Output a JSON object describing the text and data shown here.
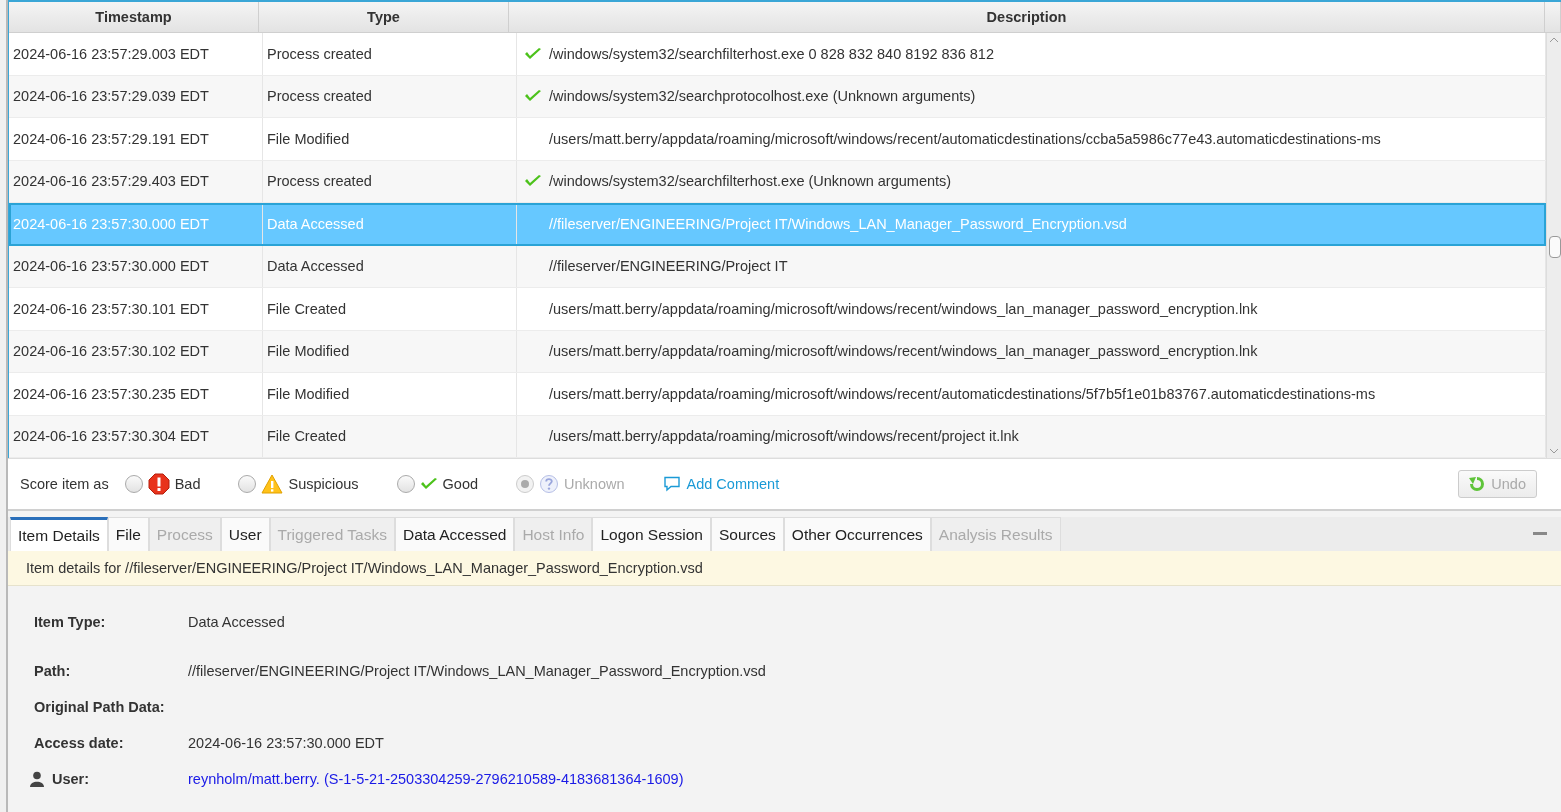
{
  "table": {
    "columns": [
      "Timestamp",
      "Type",
      "Description"
    ],
    "rows": [
      {
        "timestamp": "2024-06-16 23:57:29.003 EDT",
        "type": "Process created",
        "good": true,
        "description": "/windows/system32/searchfilterhost.exe 0 828 832 840 8192 836 812",
        "selected": false
      },
      {
        "timestamp": "2024-06-16 23:57:29.039 EDT",
        "type": "Process created",
        "good": true,
        "description": "/windows/system32/searchprotocolhost.exe (Unknown arguments)",
        "selected": false
      },
      {
        "timestamp": "2024-06-16 23:57:29.191 EDT",
        "type": "File Modified",
        "good": false,
        "description": "/users/matt.berry/appdata/roaming/microsoft/windows/recent/automaticdestinations/ccba5a5986c77e43.automaticdestinations-ms",
        "selected": false
      },
      {
        "timestamp": "2024-06-16 23:57:29.403 EDT",
        "type": "Process created",
        "good": true,
        "description": "/windows/system32/searchfilterhost.exe (Unknown arguments)",
        "selected": false
      },
      {
        "timestamp": "2024-06-16 23:57:30.000 EDT",
        "type": "Data Accessed",
        "good": false,
        "description": "//fileserver/ENGINEERING/Project IT/Windows_LAN_Manager_Password_Encryption.vsd",
        "selected": true
      },
      {
        "timestamp": "2024-06-16 23:57:30.000 EDT",
        "type": "Data Accessed",
        "good": false,
        "description": "//fileserver/ENGINEERING/Project IT",
        "selected": false
      },
      {
        "timestamp": "2024-06-16 23:57:30.101 EDT",
        "type": "File Created",
        "good": false,
        "description": "/users/matt.berry/appdata/roaming/microsoft/windows/recent/windows_lan_manager_password_encryption.lnk",
        "selected": false
      },
      {
        "timestamp": "2024-06-16 23:57:30.102 EDT",
        "type": "File Modified",
        "good": false,
        "description": "/users/matt.berry/appdata/roaming/microsoft/windows/recent/windows_lan_manager_password_encryption.lnk",
        "selected": false
      },
      {
        "timestamp": "2024-06-16 23:57:30.235 EDT",
        "type": "File Modified",
        "good": false,
        "description": "/users/matt.berry/appdata/roaming/microsoft/windows/recent/automaticdestinations/5f7b5f1e01b83767.automaticdestinations-ms",
        "selected": false
      },
      {
        "timestamp": "2024-06-16 23:57:30.304 EDT",
        "type": "File Created",
        "good": false,
        "description": "/users/matt.berry/appdata/roaming/microsoft/windows/recent/project it.lnk",
        "selected": false
      }
    ]
  },
  "score_bar": {
    "label": "Score item as",
    "options": [
      {
        "kind": "bad",
        "label": "Bad",
        "selected": false,
        "disabled": false
      },
      {
        "kind": "suspicious",
        "label": "Suspicious",
        "selected": false,
        "disabled": false
      },
      {
        "kind": "good",
        "label": "Good",
        "selected": false,
        "disabled": false
      },
      {
        "kind": "unknown",
        "label": "Unknown",
        "selected": true,
        "disabled": true
      }
    ],
    "comment_link": "Add Comment",
    "undo_button": {
      "label": "Undo",
      "disabled": true
    }
  },
  "tabs": [
    {
      "label": "Item Details",
      "selected": true,
      "disabled": false
    },
    {
      "label": "File",
      "selected": false,
      "disabled": false
    },
    {
      "label": "Process",
      "selected": false,
      "disabled": true
    },
    {
      "label": "User",
      "selected": false,
      "disabled": false
    },
    {
      "label": "Triggered Tasks",
      "selected": false,
      "disabled": true
    },
    {
      "label": "Data Accessed",
      "selected": false,
      "disabled": false
    },
    {
      "label": "Host Info",
      "selected": false,
      "disabled": true
    },
    {
      "label": "Logon Session",
      "selected": false,
      "disabled": false
    },
    {
      "label": "Sources",
      "selected": false,
      "disabled": false
    },
    {
      "label": "Other Occurrences",
      "selected": false,
      "disabled": false
    },
    {
      "label": "Analysis Results",
      "selected": false,
      "disabled": true
    }
  ],
  "info_banner": "Item details for //fileserver/ENGINEERING/Project IT/Windows_LAN_Manager_Password_Encryption.vsd",
  "details": [
    {
      "kind": "text",
      "label": "Item Type:",
      "value": "Data Accessed"
    },
    {
      "kind": "text",
      "label": "Path:",
      "value": "//fileserver/ENGINEERING/Project IT/Windows_LAN_Manager_Password_Encryption.vsd"
    },
    {
      "kind": "text",
      "label": "Original Path Data:"
    },
    {
      "kind": "text",
      "label": "Access date:",
      "value": "2024-06-16 23:57:30.000 EDT"
    },
    {
      "kind": "user",
      "label": "User:",
      "value": "reynholm/matt.berry. (S-1-5-21-2503304259-2796210589-4183681364-1609)"
    }
  ]
}
